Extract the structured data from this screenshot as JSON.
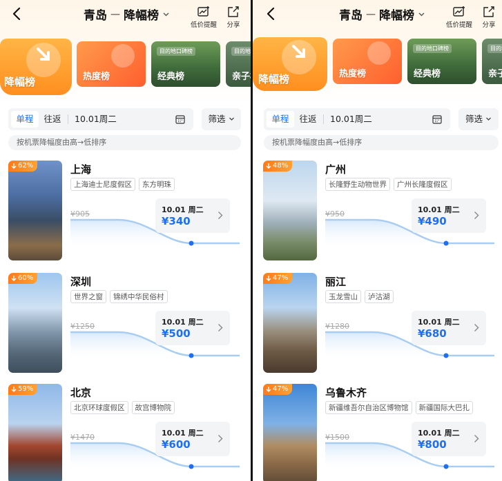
{
  "header": {
    "origin": "青岛",
    "separator": "—",
    "board_title": "降幅榜",
    "price_alert_label": "低价提醒",
    "share_label": "分享"
  },
  "boards": [
    {
      "label": "降幅榜",
      "active": true
    },
    {
      "label": "热度榜"
    },
    {
      "label": "经典榜",
      "badge": "目的地口碑榜"
    },
    {
      "label": "亲子榜",
      "badge": "目的地口碑榜"
    }
  ],
  "filters": {
    "one_way": "单程",
    "round_trip": "往返",
    "date": "10.01周二",
    "filter_label": "筛选"
  },
  "sort_tip": "按机票降幅度由高→低排序",
  "left_cards": [
    {
      "percent": "62%",
      "city": "上海",
      "tags": [
        "上海迪士尼度假区",
        "东方明珠"
      ],
      "old_price": "¥905",
      "date": "10.01 周二",
      "price": "¥340"
    },
    {
      "percent": "60%",
      "city": "深圳",
      "tags": [
        "世界之窗",
        "锦绣中华民俗村"
      ],
      "old_price": "¥1250",
      "date": "10.01 周二",
      "price": "¥500"
    },
    {
      "percent": "59%",
      "city": "北京",
      "tags": [
        "北京环球度假区",
        "故宫博物院"
      ],
      "old_price": "¥1470",
      "date": "10.01 周二",
      "price": "¥600"
    }
  ],
  "right_cards": [
    {
      "percent": "48%",
      "city": "广州",
      "tags": [
        "长隆野生动物世界",
        "广州长隆度假区"
      ],
      "old_price": "¥950",
      "date": "10.01 周二",
      "price": "¥490"
    },
    {
      "percent": "47%",
      "city": "丽江",
      "tags": [
        "玉龙雪山",
        "泸沽湖"
      ],
      "old_price": "¥1280",
      "date": "10.01 周二",
      "price": "¥680"
    },
    {
      "percent": "47%",
      "city": "乌鲁木齐",
      "tags": [
        "新疆维吾尔自治区博物馆",
        "新疆国际大巴扎"
      ],
      "old_price": "¥1500",
      "date": "10.01 周二",
      "price": "¥800"
    }
  ],
  "colors": {
    "accent_blue": "#1f6ff0",
    "orange": "#ff8f1f",
    "trend_line": "#a9cdf0"
  }
}
